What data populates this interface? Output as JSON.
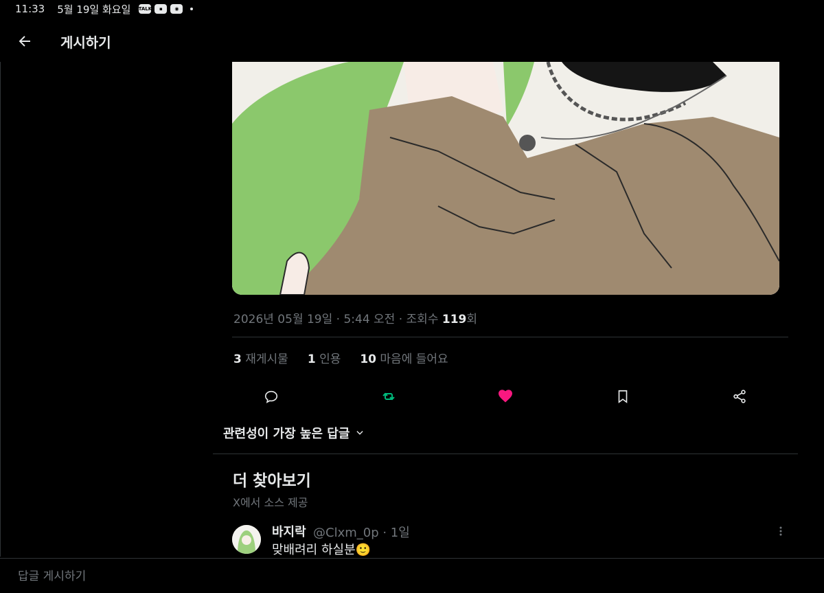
{
  "status_bar": {
    "time": "11:33",
    "date": "5월 19일 화요일",
    "icons": [
      "talk-icon",
      "notification-icon",
      "camera-icon"
    ]
  },
  "header": {
    "title": "게시하기"
  },
  "post": {
    "timestamp": "2026년 05월 19일 · 5:44 오전 · 조회수 ",
    "views": "119",
    "views_suffix": "회",
    "stats": [
      {
        "count": "3",
        "label": "재게시물"
      },
      {
        "count": "1",
        "label": "인용"
      },
      {
        "count": "10",
        "label": "마음에 들어요"
      }
    ],
    "actions": [
      "reply-icon",
      "retweet-icon",
      "like-icon",
      "bookmark-icon",
      "share-icon"
    ],
    "colors": {
      "retweet": "#00ba7c",
      "like": "#f91880"
    }
  },
  "replies_sort": {
    "label": "관련성이 가장 높은 답글"
  },
  "explore": {
    "title": "더 찾아보기",
    "subtitle": "X에서 소스 제공",
    "reply": {
      "name": "바지락",
      "handle": "@Clxm_0p · 1일",
      "text": "맞배려리 하실분🙂"
    }
  },
  "composer": {
    "placeholder": "답글 게시하기"
  },
  "theme": {
    "background": "#000000",
    "text": "#e7e9ea",
    "muted": "#71767b",
    "border": "#2f3336"
  }
}
